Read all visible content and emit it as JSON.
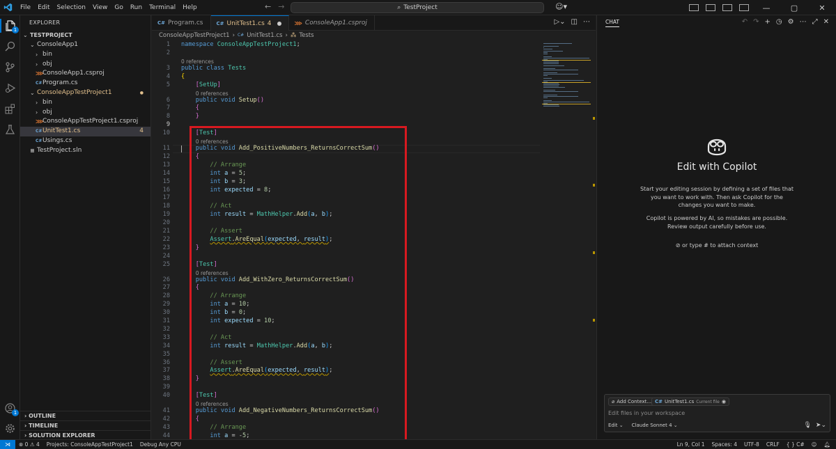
{
  "menu": [
    "File",
    "Edit",
    "Selection",
    "View",
    "Go",
    "Run",
    "Terminal",
    "Help"
  ],
  "search_text": "TestProject",
  "explorer": {
    "title": "EXPLORER",
    "root": "TESTPROJECT",
    "items": [
      {
        "label": "ConsoleApp1",
        "kind": "folder-open",
        "indent": 1
      },
      {
        "label": "bin",
        "kind": "folder",
        "indent": 2
      },
      {
        "label": "obj",
        "kind": "folder",
        "indent": 2
      },
      {
        "label": "ConsoleApp1.csproj",
        "kind": "csproj",
        "indent": 2
      },
      {
        "label": "Program.cs",
        "kind": "cs",
        "indent": 2
      },
      {
        "label": "ConsoleAppTestProject1",
        "kind": "folder-open",
        "indent": 1,
        "modified": true
      },
      {
        "label": "bin",
        "kind": "folder",
        "indent": 2
      },
      {
        "label": "obj",
        "kind": "folder",
        "indent": 2
      },
      {
        "label": "ConsoleAppTestProject1.csproj",
        "kind": "csproj",
        "indent": 2
      },
      {
        "label": "UnitTest1.cs",
        "kind": "cs",
        "indent": 2,
        "selected": true,
        "problems": "4"
      },
      {
        "label": "Usings.cs",
        "kind": "cs",
        "indent": 2
      },
      {
        "label": "TestProject.sln",
        "kind": "sln",
        "indent": 1
      }
    ],
    "sections": [
      "OUTLINE",
      "TIMELINE",
      "SOLUTION EXPLORER"
    ]
  },
  "tabs": [
    {
      "label": "Program.cs",
      "icon": "cs"
    },
    {
      "label": "UnitTest1.cs",
      "count": "4",
      "icon": "cs",
      "active": true
    },
    {
      "label": "ConsoleApp1.csproj",
      "icon": "xml",
      "italic": true
    }
  ],
  "breadcrumb": [
    "ConsoleAppTestProject1",
    "UnitTest1.cs",
    "Tests"
  ],
  "code_lines": [
    {
      "n": 1,
      "t": [
        [
          "kw",
          "namespace "
        ],
        [
          "ty",
          "ConsoleAppTestProject1"
        ],
        [
          "",
          "; "
        ]
      ]
    },
    {
      "n": 2,
      "t": []
    },
    {
      "n": 3,
      "ref": "0 references",
      "t": [
        [
          "kw",
          "public class "
        ],
        [
          "ty",
          "Tests"
        ]
      ]
    },
    {
      "n": 4,
      "t": [
        [
          "br1",
          "{"
        ]
      ]
    },
    {
      "n": 5,
      "t": [
        [
          "",
          "    "
        ],
        [
          "br2",
          "["
        ],
        [
          "ty",
          "SetUp"
        ],
        [
          "br2",
          "]"
        ]
      ]
    },
    {
      "n": 6,
      "ref": "0 references",
      "t": [
        [
          "",
          "    "
        ],
        [
          "kw",
          "public void "
        ],
        [
          "fn",
          "Setup"
        ],
        [
          "br2",
          "()"
        ]
      ]
    },
    {
      "n": 7,
      "t": [
        [
          "",
          "    "
        ],
        [
          "br2",
          "{"
        ]
      ]
    },
    {
      "n": 8,
      "t": [
        [
          "",
          "    "
        ],
        [
          "br2",
          "}"
        ]
      ]
    },
    {
      "n": 9,
      "t": [],
      "cur": true
    },
    {
      "n": 10,
      "t": [
        [
          "",
          "    "
        ],
        [
          "br2",
          "["
        ],
        [
          "ty",
          "Test"
        ],
        [
          "br2",
          "]"
        ]
      ]
    },
    {
      "n": 11,
      "ref": "0 references",
      "t": [
        [
          "",
          "    "
        ],
        [
          "kw",
          "public void "
        ],
        [
          "fn",
          "Add_PositiveNumbers_ReturnsCorrectSum"
        ],
        [
          "br2",
          "()"
        ]
      ]
    },
    {
      "n": 12,
      "t": [
        [
          "",
          "    "
        ],
        [
          "br2",
          "{"
        ]
      ]
    },
    {
      "n": 13,
      "t": [
        [
          "",
          "        "
        ],
        [
          "cm",
          "// Arrange"
        ]
      ]
    },
    {
      "n": 14,
      "t": [
        [
          "",
          "        "
        ],
        [
          "kw",
          "int "
        ],
        [
          "pa",
          "a"
        ],
        [
          "",
          " = "
        ],
        [
          "nm",
          "5"
        ],
        [
          "",
          ";"
        ]
      ]
    },
    {
      "n": 15,
      "t": [
        [
          "",
          "        "
        ],
        [
          "kw",
          "int "
        ],
        [
          "pa",
          "b"
        ],
        [
          "",
          " = "
        ],
        [
          "nm",
          "3"
        ],
        [
          "",
          ";"
        ]
      ]
    },
    {
      "n": 16,
      "t": [
        [
          "",
          "        "
        ],
        [
          "kw",
          "int "
        ],
        [
          "pa",
          "expected"
        ],
        [
          "",
          " = "
        ],
        [
          "nm",
          "8"
        ],
        [
          "",
          ";"
        ]
      ]
    },
    {
      "n": 17,
      "t": []
    },
    {
      "n": 18,
      "t": [
        [
          "",
          "        "
        ],
        [
          "cm",
          "// Act"
        ]
      ]
    },
    {
      "n": 19,
      "t": [
        [
          "",
          "        "
        ],
        [
          "kw",
          "int "
        ],
        [
          "pa",
          "result"
        ],
        [
          "",
          " = "
        ],
        [
          "ty",
          "MathHelper"
        ],
        [
          "",
          "."
        ],
        [
          "fn",
          "Add"
        ],
        [
          "br3",
          "("
        ],
        [
          "pa",
          "a"
        ],
        [
          "",
          ", "
        ],
        [
          "pa",
          "b"
        ],
        [
          "br3",
          ")"
        ],
        [
          "",
          ";"
        ]
      ]
    },
    {
      "n": 20,
      "t": []
    },
    {
      "n": 21,
      "t": [
        [
          "",
          "        "
        ],
        [
          "cm",
          "// Assert"
        ]
      ]
    },
    {
      "n": 22,
      "t": [
        [
          "",
          "        "
        ],
        [
          "ty squig",
          "Assert"
        ],
        [
          "squig",
          "."
        ],
        [
          "fn squig",
          "AreEqual"
        ],
        [
          "br3 squig",
          "("
        ],
        [
          "pa squig",
          "expected"
        ],
        [
          "squig",
          ", "
        ],
        [
          "pa squig",
          "result"
        ],
        [
          "br3 squig",
          ")"
        ],
        [
          "",
          ";"
        ]
      ]
    },
    {
      "n": 23,
      "t": [
        [
          "",
          "    "
        ],
        [
          "br2",
          "}"
        ]
      ]
    },
    {
      "n": 24,
      "t": []
    },
    {
      "n": 25,
      "t": [
        [
          "",
          "    "
        ],
        [
          "br2",
          "["
        ],
        [
          "ty",
          "Test"
        ],
        [
          "br2",
          "]"
        ]
      ]
    },
    {
      "n": 26,
      "ref": "0 references",
      "t": [
        [
          "",
          "    "
        ],
        [
          "kw",
          "public void "
        ],
        [
          "fn",
          "Add_WithZero_ReturnsCorrectSum"
        ],
        [
          "br2",
          "()"
        ]
      ]
    },
    {
      "n": 27,
      "t": [
        [
          "",
          "    "
        ],
        [
          "br2",
          "{"
        ]
      ]
    },
    {
      "n": 28,
      "t": [
        [
          "",
          "        "
        ],
        [
          "cm",
          "// Arrange"
        ]
      ]
    },
    {
      "n": 29,
      "t": [
        [
          "",
          "        "
        ],
        [
          "kw",
          "int "
        ],
        [
          "pa",
          "a"
        ],
        [
          "",
          " = "
        ],
        [
          "nm",
          "10"
        ],
        [
          "",
          ";"
        ]
      ]
    },
    {
      "n": 30,
      "t": [
        [
          "",
          "        "
        ],
        [
          "kw",
          "int "
        ],
        [
          "pa",
          "b"
        ],
        [
          "",
          " = "
        ],
        [
          "nm",
          "0"
        ],
        [
          "",
          ";"
        ]
      ]
    },
    {
      "n": 31,
      "t": [
        [
          "",
          "        "
        ],
        [
          "kw",
          "int "
        ],
        [
          "pa",
          "expected"
        ],
        [
          "",
          " = "
        ],
        [
          "nm",
          "10"
        ],
        [
          "",
          ";"
        ]
      ]
    },
    {
      "n": 32,
      "t": []
    },
    {
      "n": 33,
      "t": [
        [
          "",
          "        "
        ],
        [
          "cm",
          "// Act"
        ]
      ]
    },
    {
      "n": 34,
      "t": [
        [
          "",
          "        "
        ],
        [
          "kw",
          "int "
        ],
        [
          "pa",
          "result"
        ],
        [
          "",
          " = "
        ],
        [
          "ty",
          "MathHelper"
        ],
        [
          "",
          "."
        ],
        [
          "fn",
          "Add"
        ],
        [
          "br3",
          "("
        ],
        [
          "pa",
          "a"
        ],
        [
          "",
          ", "
        ],
        [
          "pa",
          "b"
        ],
        [
          "br3",
          ")"
        ],
        [
          "",
          ";"
        ]
      ]
    },
    {
      "n": 35,
      "t": []
    },
    {
      "n": 36,
      "t": [
        [
          "",
          "        "
        ],
        [
          "cm",
          "// Assert"
        ]
      ]
    },
    {
      "n": 37,
      "t": [
        [
          "",
          "        "
        ],
        [
          "ty squig",
          "Assert"
        ],
        [
          "squig",
          "."
        ],
        [
          "fn squig",
          "AreEqual"
        ],
        [
          "br3 squig",
          "("
        ],
        [
          "pa squig",
          "expected"
        ],
        [
          "squig",
          ", "
        ],
        [
          "pa squig",
          "result"
        ],
        [
          "br3 squig",
          ")"
        ],
        [
          "",
          ";"
        ]
      ]
    },
    {
      "n": 38,
      "t": [
        [
          "",
          "    "
        ],
        [
          "br2",
          "}"
        ]
      ]
    },
    {
      "n": 39,
      "t": []
    },
    {
      "n": 40,
      "t": [
        [
          "",
          "    "
        ],
        [
          "br2",
          "["
        ],
        [
          "ty",
          "Test"
        ],
        [
          "br2",
          "]"
        ]
      ]
    },
    {
      "n": 41,
      "ref": "0 references",
      "t": [
        [
          "",
          "    "
        ],
        [
          "kw",
          "public void "
        ],
        [
          "fn",
          "Add_NegativeNumbers_ReturnsCorrectSum"
        ],
        [
          "br2",
          "()"
        ]
      ]
    },
    {
      "n": 42,
      "t": [
        [
          "",
          "    "
        ],
        [
          "br2",
          "{"
        ]
      ]
    },
    {
      "n": 43,
      "t": [
        [
          "",
          "        "
        ],
        [
          "cm",
          "// Arrange"
        ]
      ]
    },
    {
      "n": 44,
      "t": [
        [
          "",
          "        "
        ],
        [
          "kw",
          "int "
        ],
        [
          "pa",
          "a"
        ],
        [
          "",
          " = -"
        ],
        [
          "nm",
          "5"
        ],
        [
          "",
          ";"
        ]
      ]
    }
  ],
  "chat": {
    "tab": "CHAT",
    "title": "Edit with Copilot",
    "para1": "Start your editing session by defining a set of files that you want to work with. Then ask Copilot for the changes you want to make.",
    "para2": "Copilot is powered by AI, so mistakes are possible. Review output carefully before use.",
    "attach_hint": "or type # to attach context",
    "add_context": "Add Context...",
    "file_chip": "UnitTest1.cs",
    "file_chip_sub": "Current file",
    "placeholder": "Edit files in your workspace",
    "mode": "Edit",
    "model": "Claude Sonnet 4"
  },
  "status": {
    "errors": "0",
    "warnings": "4",
    "projects": "Projects: ConsoleAppTestProject1",
    "debug": "Debug Any CPU",
    "position": "Ln 9, Col 1",
    "spaces": "Spaces: 4",
    "encoding": "UTF-8",
    "eol": "CRLF",
    "language": "C#"
  },
  "colors": {
    "accent": "#0078d4",
    "highlight_box": "#d71920"
  }
}
